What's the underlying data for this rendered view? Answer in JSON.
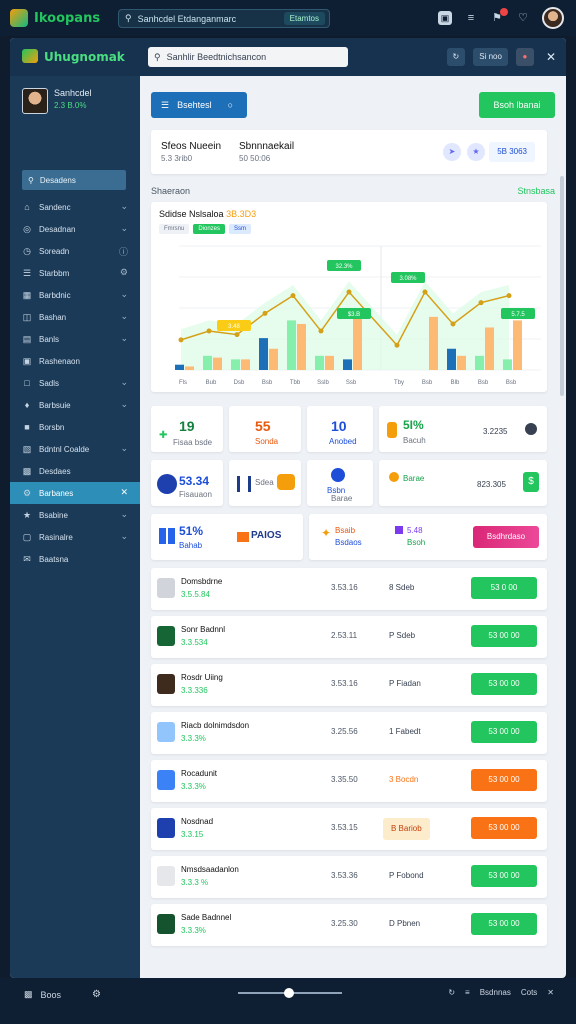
{
  "topbar": {
    "app_name": "Ikoopans",
    "search_text": "Sanhcdel Etdanganmarc",
    "search_chip": "Etamtos"
  },
  "window": {
    "app_name": "Uhugnomak",
    "search_placeholder": "Sanhlir Beedtnichsancon",
    "btn_right": "Si noo"
  },
  "sidebar": {
    "profile": {
      "name": "Sanhcdel",
      "value": "2.3 B.0%"
    },
    "search_label": "Desadens",
    "items": [
      {
        "label": "Sandenc",
        "icon": "home-icon"
      },
      {
        "label": "Desadnan",
        "icon": "compass-icon"
      },
      {
        "label": "Soreadn",
        "icon": "clock-icon"
      },
      {
        "label": "Starbbm",
        "icon": "layers-icon"
      },
      {
        "label": "Barbdnic",
        "icon": "grid-icon"
      },
      {
        "label": "Bashan",
        "icon": "table-icon"
      },
      {
        "label": "Banls",
        "icon": "chart-icon"
      },
      {
        "label": "Rashenaon",
        "icon": "folder-icon"
      },
      {
        "label": "Sadls",
        "icon": "doc-icon"
      },
      {
        "label": "Barbsuie",
        "icon": "bell-icon"
      },
      {
        "label": "Borsbn",
        "icon": "user-icon"
      },
      {
        "label": "Bdntnl Coalde",
        "icon": "calendar-icon"
      },
      {
        "label": "Desdaes",
        "icon": "tag-icon"
      },
      {
        "label": "Barbanes",
        "icon": "settings-icon"
      },
      {
        "label": "Bsabine",
        "icon": "star-icon"
      },
      {
        "label": "Rasinalre",
        "icon": "box-icon"
      },
      {
        "label": "Baatsna",
        "icon": "mail-icon"
      }
    ]
  },
  "toolbar": {
    "filter_label": "Bsehtesl",
    "action_label": "Bsoh lbanai"
  },
  "summary": {
    "title1": "Sfeos Nueein",
    "sub1": "5.3 3rib0",
    "title2": "Sbnnnaekail",
    "sub2": "50 50:06",
    "right_badge": "5B 3063"
  },
  "section": {
    "label": "Shaeraon",
    "right": "Stnsbasa"
  },
  "chart_card": {
    "title": "Sdidse Nslsaloa",
    "title_accent": "3B.3D3",
    "legend": [
      "Fmrsnu",
      "Dionzes",
      "Ssm"
    ],
    "ann": [
      "32.3%",
      "3.48",
      "$3.B",
      "3.08%",
      "5.7.5"
    ]
  },
  "chart_data": {
    "type": "bar",
    "categories": [
      "Fls",
      "Bub",
      "Dsb",
      "Bsb",
      "Tbb",
      "Sslb",
      "Ssb",
      "Tby",
      "Bsb",
      "Blb",
      "Bsb",
      "Bsb"
    ],
    "series": [
      {
        "name": "Fmrsnu",
        "values": [
          3,
          8,
          6,
          18,
          28,
          8,
          6,
          0,
          0,
          12,
          8,
          6
        ]
      },
      {
        "name": "Dionzes",
        "values": [
          2,
          7,
          6,
          12,
          26,
          8,
          30,
          0,
          30,
          8,
          24,
          28
        ]
      }
    ],
    "ylabel": "",
    "ylim": [
      0,
      70
    ]
  },
  "stats_row1": [
    {
      "big": "19",
      "sub": "Fisaa bsde"
    },
    {
      "big": "55",
      "sub": "Sonda"
    },
    {
      "big": "10",
      "sub": "Anobed"
    },
    {
      "big": "5I%",
      "sub": "Bacuh"
    },
    {
      "big": "3.2235",
      "sub": ""
    }
  ],
  "stats_row2": [
    {
      "big": "53.34",
      "sub": "Fisauaon"
    },
    {
      "big": "Sdea",
      "sub": ""
    },
    {
      "big": "Bsbn",
      "sub": "Barae"
    },
    {
      "big": "823.305",
      "sub": ""
    }
  ],
  "stats_row3": [
    {
      "big": "51%",
      "sub": "Bahab"
    },
    {
      "big": "PAIOS",
      "sub": ""
    },
    {
      "big": "Bsaib",
      "sub": "Bsdaos"
    },
    {
      "big": "5.48",
      "sub": "Bsoh"
    },
    {
      "big": "Bsdhrdaso",
      "sub": ""
    }
  ],
  "list": [
    {
      "name": "Domsbdrne",
      "sub": "3.5.5.84",
      "value": "3.53.16",
      "status": "8  Sdeb",
      "btn": "53 0 00",
      "btn_color": "green"
    },
    {
      "name": "Sonr Badnnl",
      "sub": "3.3.534",
      "value": "2.53.11",
      "status": "P  Sdeb",
      "btn": "53 00 00",
      "btn_color": "green"
    },
    {
      "name": "Rosdr Uiing",
      "sub": "3.3.336",
      "value": "3.53.16",
      "status": "P  Fiadan",
      "btn": "53 00 00",
      "btn_color": "green"
    },
    {
      "name": "Riacb dolnimdsdon",
      "sub": "3.3.3%",
      "value": "3.25.56",
      "status": "1  Fabedt",
      "btn": "53 00 00",
      "btn_color": "green"
    },
    {
      "name": "Rocadunit",
      "sub": "3.3.3%",
      "value": "3.35.50",
      "status": "3  Bocdn",
      "btn": "53 00 00",
      "btn_color": "orange"
    },
    {
      "name": "Nosdnad",
      "sub": "3.3.15",
      "value": "3.53.15",
      "status": "B Bariob",
      "btn": "53 00 00",
      "btn_color": "orange"
    },
    {
      "name": "Nmsdsaadanlon",
      "sub": "3.3.3 %",
      "value": "3.53.36",
      "status": "P  Fobond",
      "btn": "53 00 00",
      "btn_color": "green"
    },
    {
      "name": "Sade Badnnel",
      "sub": "3.3.3%",
      "value": "3.25.30",
      "status": "D  Pbnen",
      "btn": "53 00 00",
      "btn_color": "green"
    }
  ],
  "bottombar": {
    "left_label": "Boos",
    "right_label1": "Bsdnnas",
    "right_label2": "Cots"
  }
}
